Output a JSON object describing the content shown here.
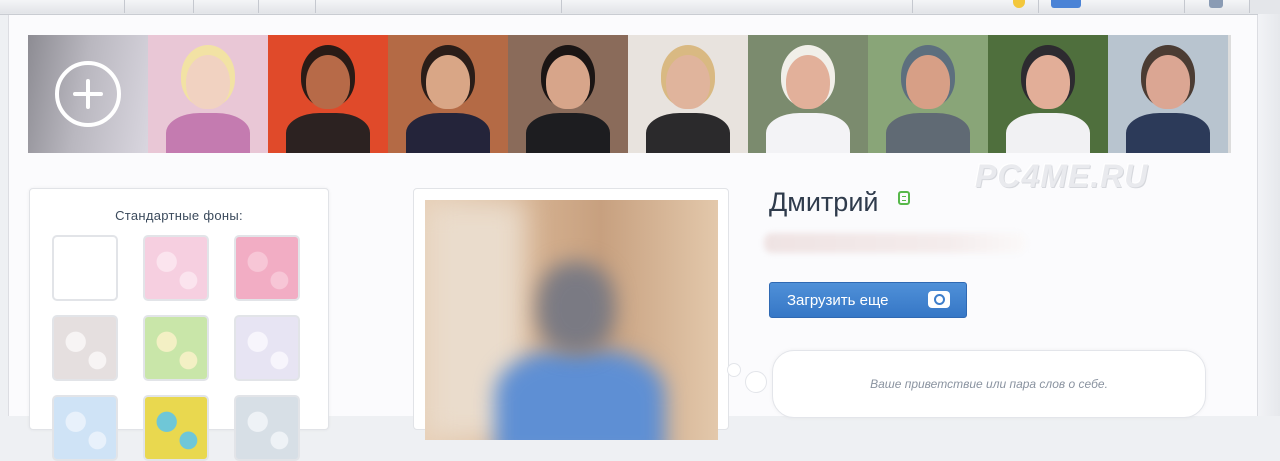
{
  "friends_strip": {
    "add_label": "",
    "photos": [
      {
        "name": "friend-1",
        "bg": "#e9c7d6",
        "skin": "#f1d2c1",
        "hair": "#f2e2a4",
        "shirt": "#c47bb0"
      },
      {
        "name": "friend-2",
        "bg": "#e04a2a",
        "skin": "#b76a48",
        "hair": "#2a1b16",
        "shirt": "#2c2221"
      },
      {
        "name": "friend-3",
        "bg": "#b46a45",
        "skin": "#d9a686",
        "hair": "#2b1d18",
        "shirt": "#24243a"
      },
      {
        "name": "friend-4",
        "bg": "#8a6b5a",
        "skin": "#d7a58a",
        "hair": "#1b1514",
        "shirt": "#1d1d20"
      },
      {
        "name": "friend-5",
        "bg": "#e8e3de",
        "skin": "#e0b49c",
        "hair": "#d9b982",
        "shirt": "#2b2a2c"
      },
      {
        "name": "friend-6",
        "bg": "#7b8b6e",
        "skin": "#e2b09a",
        "hair": "#f1efe9",
        "shirt": "#f3f3f6"
      },
      {
        "name": "friend-7",
        "bg": "#89a578",
        "skin": "#d79f86",
        "hair": "#5d6f7e",
        "shirt": "#606a74"
      },
      {
        "name": "friend-8",
        "bg": "#4f6f3d",
        "skin": "#e2ae98",
        "hair": "#2d2b30",
        "shirt": "#f1f1f3"
      },
      {
        "name": "friend-9",
        "bg": "#b8c4cf",
        "skin": "#dba693",
        "hair": "#4b3c33",
        "shirt": "#2c3a59"
      }
    ]
  },
  "watermark": "PC4ME.RU",
  "backgrounds_panel": {
    "title": "Стандартные фоны:",
    "swatches": [
      {
        "name": "swatch-white",
        "color": "#ffffff",
        "accent": "#ffffff"
      },
      {
        "name": "swatch-pink-hearts",
        "color": "#f6cfe0",
        "accent": "#fbe4ee"
      },
      {
        "name": "swatch-pink-swirls",
        "color": "#f2adc4",
        "accent": "#f7c6d6"
      },
      {
        "name": "swatch-gray-flowers",
        "color": "#e5dfdf",
        "accent": "#f7f4f4"
      },
      {
        "name": "swatch-green-flowers",
        "color": "#c9e6a9",
        "accent": "#f3f0c4"
      },
      {
        "name": "swatch-lilac-flowers",
        "color": "#e7e4f3",
        "accent": "#f7f5fc"
      },
      {
        "name": "swatch-blue",
        "color": "#cfe3f6",
        "accent": "#e8f1fb"
      },
      {
        "name": "swatch-yellow",
        "color": "#e9d84f",
        "accent": "#6fc7d7"
      },
      {
        "name": "swatch-gray-blue",
        "color": "#d7dfe6",
        "accent": "#eef2f6"
      }
    ]
  },
  "profile": {
    "name": "Дмитрий",
    "upload_button": "Загрузить еще",
    "status_placeholder": "Ваше приветствие или пара слов о себе."
  }
}
